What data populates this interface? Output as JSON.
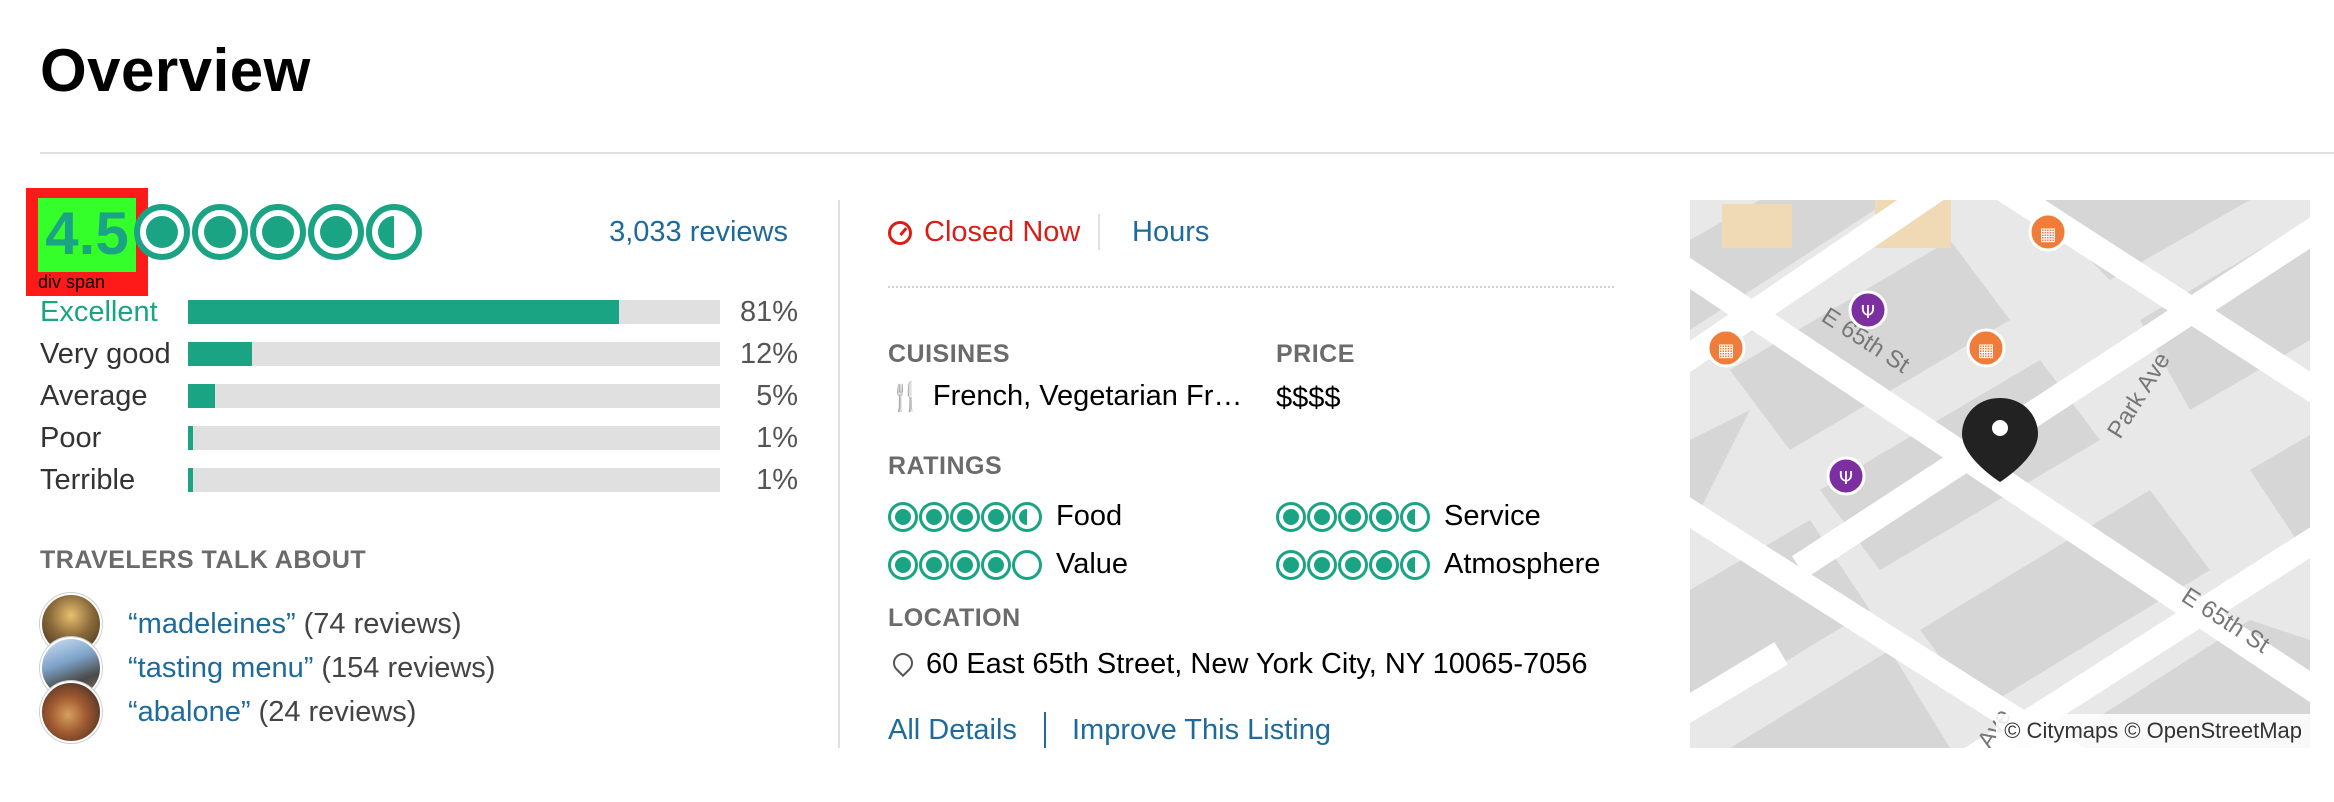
{
  "title": "Overview",
  "rating": {
    "score": "4.5",
    "debug_label": "div span",
    "bubbles": 4.5,
    "reviews_link": "3,033 reviews",
    "distribution": [
      {
        "label": "Excellent",
        "percent": "81%",
        "value": 81
      },
      {
        "label": "Very good",
        "percent": "12%",
        "value": 12
      },
      {
        "label": "Average",
        "percent": "5%",
        "value": 5
      },
      {
        "label": "Poor",
        "percent": "1%",
        "value": 1
      },
      {
        "label": "Terrible",
        "percent": "1%",
        "value": 1
      }
    ]
  },
  "travelers": {
    "heading": "TRAVELERS TALK ABOUT",
    "items": [
      {
        "term": "“madeleines”",
        "count": "(74 reviews)"
      },
      {
        "term": "“tasting menu”",
        "count": "(154 reviews)"
      },
      {
        "term": "“abalone”",
        "count": "(24 reviews)"
      }
    ]
  },
  "status": {
    "closed": "Closed Now",
    "hours": "Hours"
  },
  "details": {
    "cuisines_heading": "CUISINES",
    "cuisines": "French, Vegetarian Fr…",
    "price_heading": "PRICE",
    "price": "$$$$",
    "ratings_heading": "RATINGS",
    "ratings": [
      {
        "label": "Food",
        "bubbles": 4.5
      },
      {
        "label": "Service",
        "bubbles": 4.5
      },
      {
        "label": "Value",
        "bubbles": 4
      },
      {
        "label": "Atmosphere",
        "bubbles": 4.5
      }
    ],
    "location_heading": "LOCATION",
    "address": "60 East 65th Street, New York City, NY 10065-7056",
    "all_details": "All Details",
    "improve": "Improve This Listing"
  },
  "map": {
    "street_1": "E 65th St",
    "street_2": "Park Ave",
    "street_3": "E 65th St",
    "street_4": "Ave",
    "attribution": "© Citymaps © OpenStreetMap"
  },
  "colors": {
    "accent": "#1aa483",
    "link": "#1d6a9b",
    "closed": "#d91e18"
  }
}
